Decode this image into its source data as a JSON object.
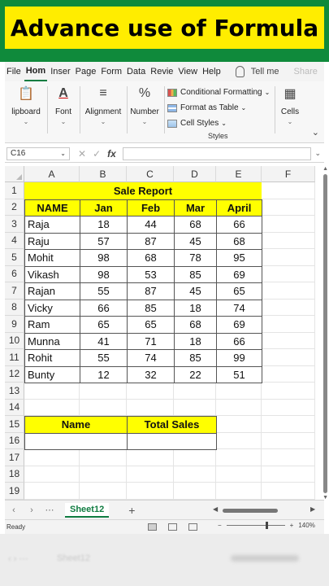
{
  "banner": {
    "title": "Advance use of Formula"
  },
  "menu": {
    "tabs": [
      "File",
      "Hom",
      "Inser",
      "Page",
      "Form",
      "Data",
      "Revie",
      "View",
      "Help"
    ],
    "active": "Hom",
    "tell_me": "Tell me",
    "share": "Share"
  },
  "ribbon": {
    "clipboard": "lipboard",
    "font": "Font",
    "alignment": "Alignment",
    "number": "Number",
    "conditional_formatting": "Conditional Formatting",
    "format_as_table": "Format as Table",
    "cell_styles": "Cell Styles",
    "styles_group": "Styles",
    "cells": "Cells"
  },
  "formula_bar": {
    "name_box": "C16",
    "fx": "fx",
    "value": ""
  },
  "columns": [
    "A",
    "B",
    "C",
    "D",
    "E",
    "F"
  ],
  "rows": [
    "1",
    "2",
    "3",
    "4",
    "5",
    "6",
    "7",
    "8",
    "9",
    "10",
    "11",
    "12",
    "13",
    "14",
    "15",
    "16",
    "17",
    "18",
    "19"
  ],
  "sheet": {
    "title": "Sale Report",
    "headers": [
      "NAME",
      "Jan",
      "Feb",
      "Mar",
      "April"
    ],
    "records": [
      [
        "Raja",
        "18",
        "44",
        "68",
        "66"
      ],
      [
        "Raju",
        "57",
        "87",
        "45",
        "68"
      ],
      [
        "Mohit",
        "98",
        "68",
        "78",
        "95"
      ],
      [
        "Vikash",
        "98",
        "53",
        "85",
        "69"
      ],
      [
        "Rajan",
        "55",
        "87",
        "45",
        "65"
      ],
      [
        "Vicky",
        "66",
        "85",
        "18",
        "74"
      ],
      [
        "Ram",
        "65",
        "65",
        "68",
        "69"
      ],
      [
        "Munna",
        "41",
        "71",
        "18",
        "66"
      ],
      [
        "Rohit",
        "55",
        "74",
        "85",
        "99"
      ],
      [
        "Bunty",
        "12",
        "32",
        "22",
        "51"
      ]
    ],
    "summary_headers": [
      "Name",
      "Total Sales"
    ],
    "highlight_color": "#ffff00"
  },
  "tabs": {
    "sheet": "Sheet12",
    "add": "+"
  },
  "status": {
    "ready": "Ready",
    "zoom": "140%"
  },
  "footer": {
    "sheet_ghost": "Sheet12"
  }
}
